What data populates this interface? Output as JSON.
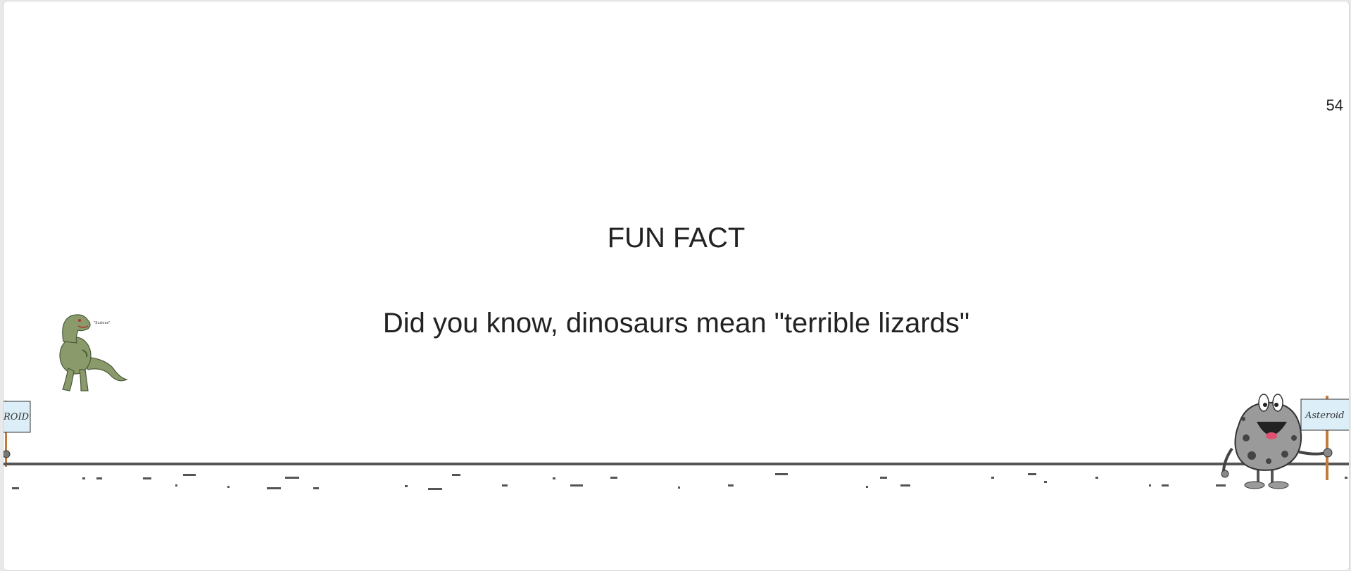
{
  "game": {
    "score": "54",
    "fact_title": "FUN FACT",
    "fact_text": "Did you know, dinosaurs mean \"terrible lizards\"",
    "dino_speech": "\"Scalvas\"",
    "left_sign_text": "ROID",
    "asteroid_sign_text": "Asteroid"
  },
  "colors": {
    "ground": "#555555",
    "dino": "#8a9a6a",
    "asteroid": "#9a9a9a",
    "sign": "#dceef8"
  }
}
